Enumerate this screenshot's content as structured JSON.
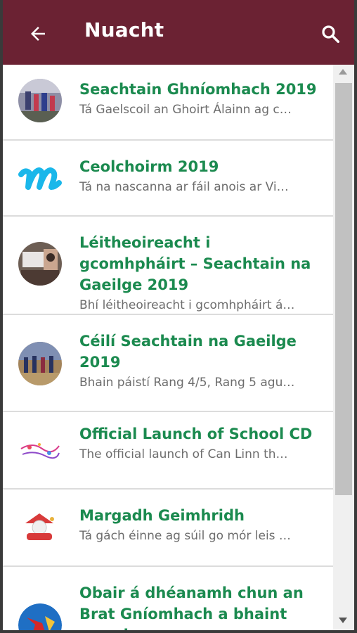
{
  "header": {
    "title": "Nuacht",
    "back_icon": "arrow-left-icon",
    "search_icon": "search-icon"
  },
  "colors": {
    "appbar": "#6b2233",
    "title_green": "#1b8a4f",
    "subtitle_gray": "#6d6d6d"
  },
  "news": [
    {
      "title": "Seachtain Ghníomhach 2019",
      "summary": "Tá Gaelscoil an Ghoirt Álainn ag c…"
    },
    {
      "title": "Ceolchoirm 2019",
      "summary": "Tá na nascanna ar fáil anois ar Vi…"
    },
    {
      "title": "Léitheoireacht i gcomhpháirt – Seachtain na Gaeilge 2019",
      "summary": "Bhí léitheoireacht i gcomhpháirt á…"
    },
    {
      "title": "Céilí Seachtain na Gaeilge 2019",
      "summary": "Bhain páistí Rang 4/5, Rang 5 agu…"
    },
    {
      "title": "Official Launch of School CD",
      "summary": "The official launch of Can Linn th…"
    },
    {
      "title": "Margadh Geimhridh",
      "summary": "Tá gách éinne ag súil go mór leis …"
    },
    {
      "title": "Obair á dhéanamh chun an Brat Gníomhach a bhaint amach",
      "summary": ""
    }
  ]
}
